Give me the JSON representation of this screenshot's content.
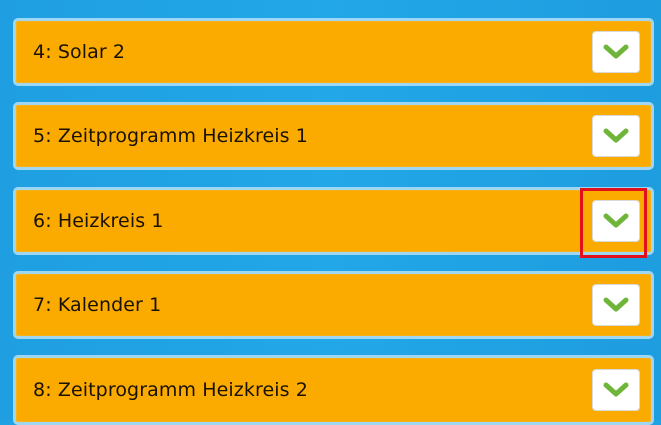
{
  "list": {
    "items": [
      {
        "label": "4: Solar 2",
        "icon": "chevron-down-icon"
      },
      {
        "label": "5: Zeitprogramm Heizkreis 1",
        "icon": "chevron-down-icon"
      },
      {
        "label": "6: Heizkreis 1",
        "icon": "chevron-down-icon",
        "highlighted": true
      },
      {
        "label": "7: Kalender 1",
        "icon": "chevron-down-icon"
      },
      {
        "label": "8: Zeitprogramm Heizkreis 2",
        "icon": "chevron-down-icon"
      }
    ]
  },
  "colors": {
    "background": "#1fa2e4",
    "row_fill": "#fbaa00",
    "row_border": "#9fd6f1",
    "chevron": "#6fb53a",
    "highlight": "#e0101c"
  }
}
